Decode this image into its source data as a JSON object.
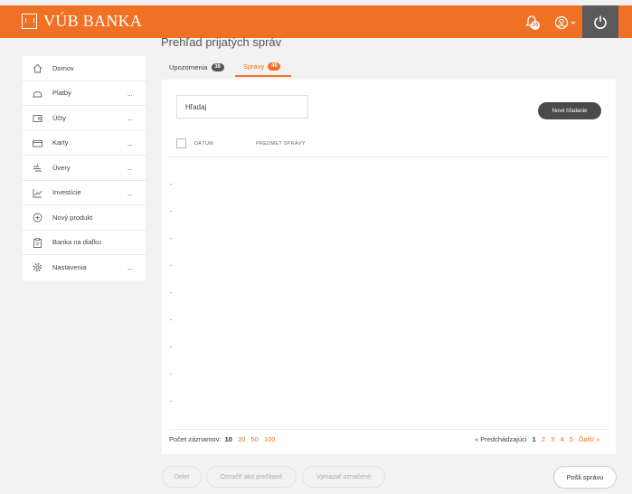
{
  "header": {
    "brand": "VÚB BANKA",
    "notification_count": "16"
  },
  "page": {
    "title": "Prehľad prijatých správ"
  },
  "sidebar": {
    "items": [
      {
        "label": "Domov",
        "icon": "home-icon",
        "has_more": false
      },
      {
        "label": "Platby",
        "icon": "payments-icon",
        "has_more": true,
        "more": "..."
      },
      {
        "label": "Účty",
        "icon": "wallet-icon",
        "has_more": true,
        "more": "..."
      },
      {
        "label": "Karty",
        "icon": "card-icon",
        "has_more": true,
        "more": "..."
      },
      {
        "label": "Úvery",
        "icon": "loan-icon",
        "has_more": true,
        "more": "..."
      },
      {
        "label": "Investície",
        "icon": "chart-icon",
        "has_more": true,
        "more": "..."
      },
      {
        "label": "Nový produkt",
        "icon": "plus-circle-icon",
        "has_more": false
      },
      {
        "label": "Banka na diaľku",
        "icon": "clipboard-icon",
        "has_more": false
      },
      {
        "label": "Nastavenia",
        "icon": "gear-icon",
        "has_more": true,
        "more": "..."
      }
    ]
  },
  "tabs": [
    {
      "label": "Upozornenia",
      "count": "38",
      "active": false
    },
    {
      "label": "Správy",
      "count": "40",
      "active": true
    }
  ],
  "search": {
    "placeholder": "Hľadaj",
    "button": "Nové hľadanie"
  },
  "table": {
    "columns": [
      "DÁTUM",
      "PREDMET SPRÁVY"
    ]
  },
  "pagination": {
    "records_label": "Počet záznamov:",
    "page_sizes": [
      "10",
      "20",
      "50",
      "100"
    ],
    "current_size": "10",
    "prev": "«  Predchádzajúci",
    "pages": [
      "1",
      "2",
      "3",
      "4",
      "5"
    ],
    "current_page": "1",
    "next": "Ďalší  »"
  },
  "actions": {
    "delete": "Delet",
    "mark_read": "Označiť ako prečítané",
    "clear_marked": "Vymazať označené",
    "send": "Pošli správu"
  },
  "colors": {
    "accent": "#f07124",
    "dark": "#4a4a4a",
    "background": "#f2f2f2"
  }
}
